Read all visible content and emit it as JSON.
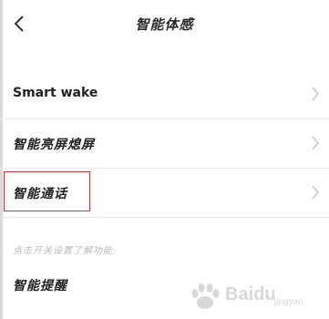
{
  "header": {
    "title": "智能体感"
  },
  "settings": {
    "items": [
      {
        "label": "Smart wake"
      },
      {
        "label": "智能亮屏熄屏"
      },
      {
        "label": "智能通话"
      }
    ],
    "note": "点击开关设置了解功能",
    "section_item": "智能提醒"
  },
  "watermark": {
    "text": "Baidu",
    "sub": "jingyan"
  },
  "colors": {
    "highlight": "#d4353a",
    "chevron": "#c8c8c8"
  }
}
